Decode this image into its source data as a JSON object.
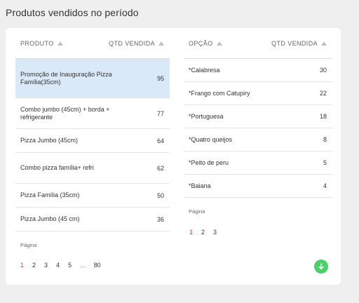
{
  "page": {
    "title": "Produtos vendidos no período"
  },
  "left_table": {
    "headers": {
      "product": "PRODUTO",
      "qty": "QTD VENDIDA"
    },
    "rows": [
      {
        "name": "Promoção de Inauguração Pizza Família(35cm)",
        "qty": "95",
        "selected": true
      },
      {
        "name": "Combo jumbo (45cm) + borda + refrigerante",
        "qty": "77"
      },
      {
        "name": "Pizza Jumbo (45cm)",
        "qty": "64"
      },
      {
        "name": "Combo pizza família+ refri",
        "qty": "62"
      },
      {
        "name": "Pizza Família (35cm)",
        "qty": "50"
      },
      {
        "name": "Pizza Jumbo (45 cm)",
        "qty": "36"
      }
    ],
    "pagination": {
      "label": "Página",
      "pages": [
        "1",
        "2",
        "3",
        "4",
        "5",
        "...",
        "80"
      ],
      "active": "1"
    }
  },
  "right_table": {
    "headers": {
      "option": "OPÇÃO",
      "qty": "QTD VENDIDA"
    },
    "rows": [
      {
        "name": "*Calabresa",
        "qty": "30"
      },
      {
        "name": "*Frango com Catupiry",
        "qty": "22"
      },
      {
        "name": "*Portuguesa",
        "qty": "18"
      },
      {
        "name": "*Quatro queijos",
        "qty": "8"
      },
      {
        "name": "*Peito de peru",
        "qty": "5"
      },
      {
        "name": "*Baiana",
        "qty": "4"
      }
    ],
    "pagination": {
      "label": "Página",
      "pages": [
        "1",
        "2",
        "3"
      ],
      "active": "1"
    }
  },
  "download_button": {
    "icon": "arrow-down-icon",
    "color": "#4cd06a"
  },
  "colors": {
    "selected_row": "#d9e9f7",
    "active_page": "#e53935"
  }
}
